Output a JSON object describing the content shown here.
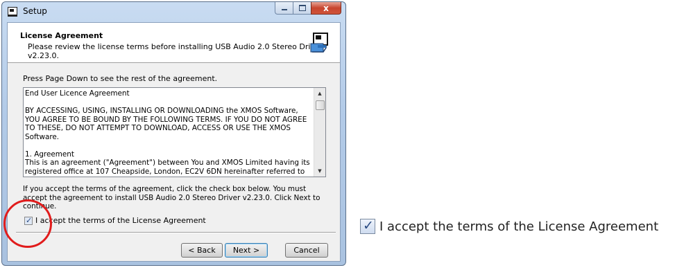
{
  "window": {
    "title": "Setup",
    "close_glyph": "x"
  },
  "header": {
    "title": "License Agreement",
    "subtitle": "Please review the license terms before installing USB Audio 2.0 Stereo Driver v2.23.0."
  },
  "prompt": "Press Page Down to see the rest of the agreement.",
  "license_text": "End User Licence Agreement\n\nBY ACCESSING, USING, INSTALLING OR DOWNLOADING the XMOS Software, YOU AGREE TO BE BOUND BY THE FOLLOWING TERMS. IF YOU DO NOT AGREE TO THESE, DO NOT ATTEMPT TO DOWNLOAD, ACCESS OR USE THE XMOS Software.\n\n1. Agreement\nThis is an agreement (\"Agreement\") between You and XMOS Limited having its registered office at 107 Cheapside, London, EC2V 6DN hereinafter referred to as \"XMOS\". If you are entering into this Agreement on behalf of another legal entity such as a company,",
  "instructions": "If you accept the terms of the agreement, click the check box below. You must accept the agreement to install USB Audio 2.0 Stereo Driver v2.23.0. Click Next to continue.",
  "accept_checkbox": {
    "label": "I accept the terms of the License Agreement",
    "checked": true
  },
  "buttons": {
    "back": "< Back",
    "next": "Next >",
    "cancel": "Cancel"
  },
  "callout": {
    "label": "I accept the terms of the License Agreement"
  },
  "colors": {
    "annotation": "#e11c1c",
    "title_bar": "#b3cbe8",
    "close_button": "#c7452f"
  }
}
